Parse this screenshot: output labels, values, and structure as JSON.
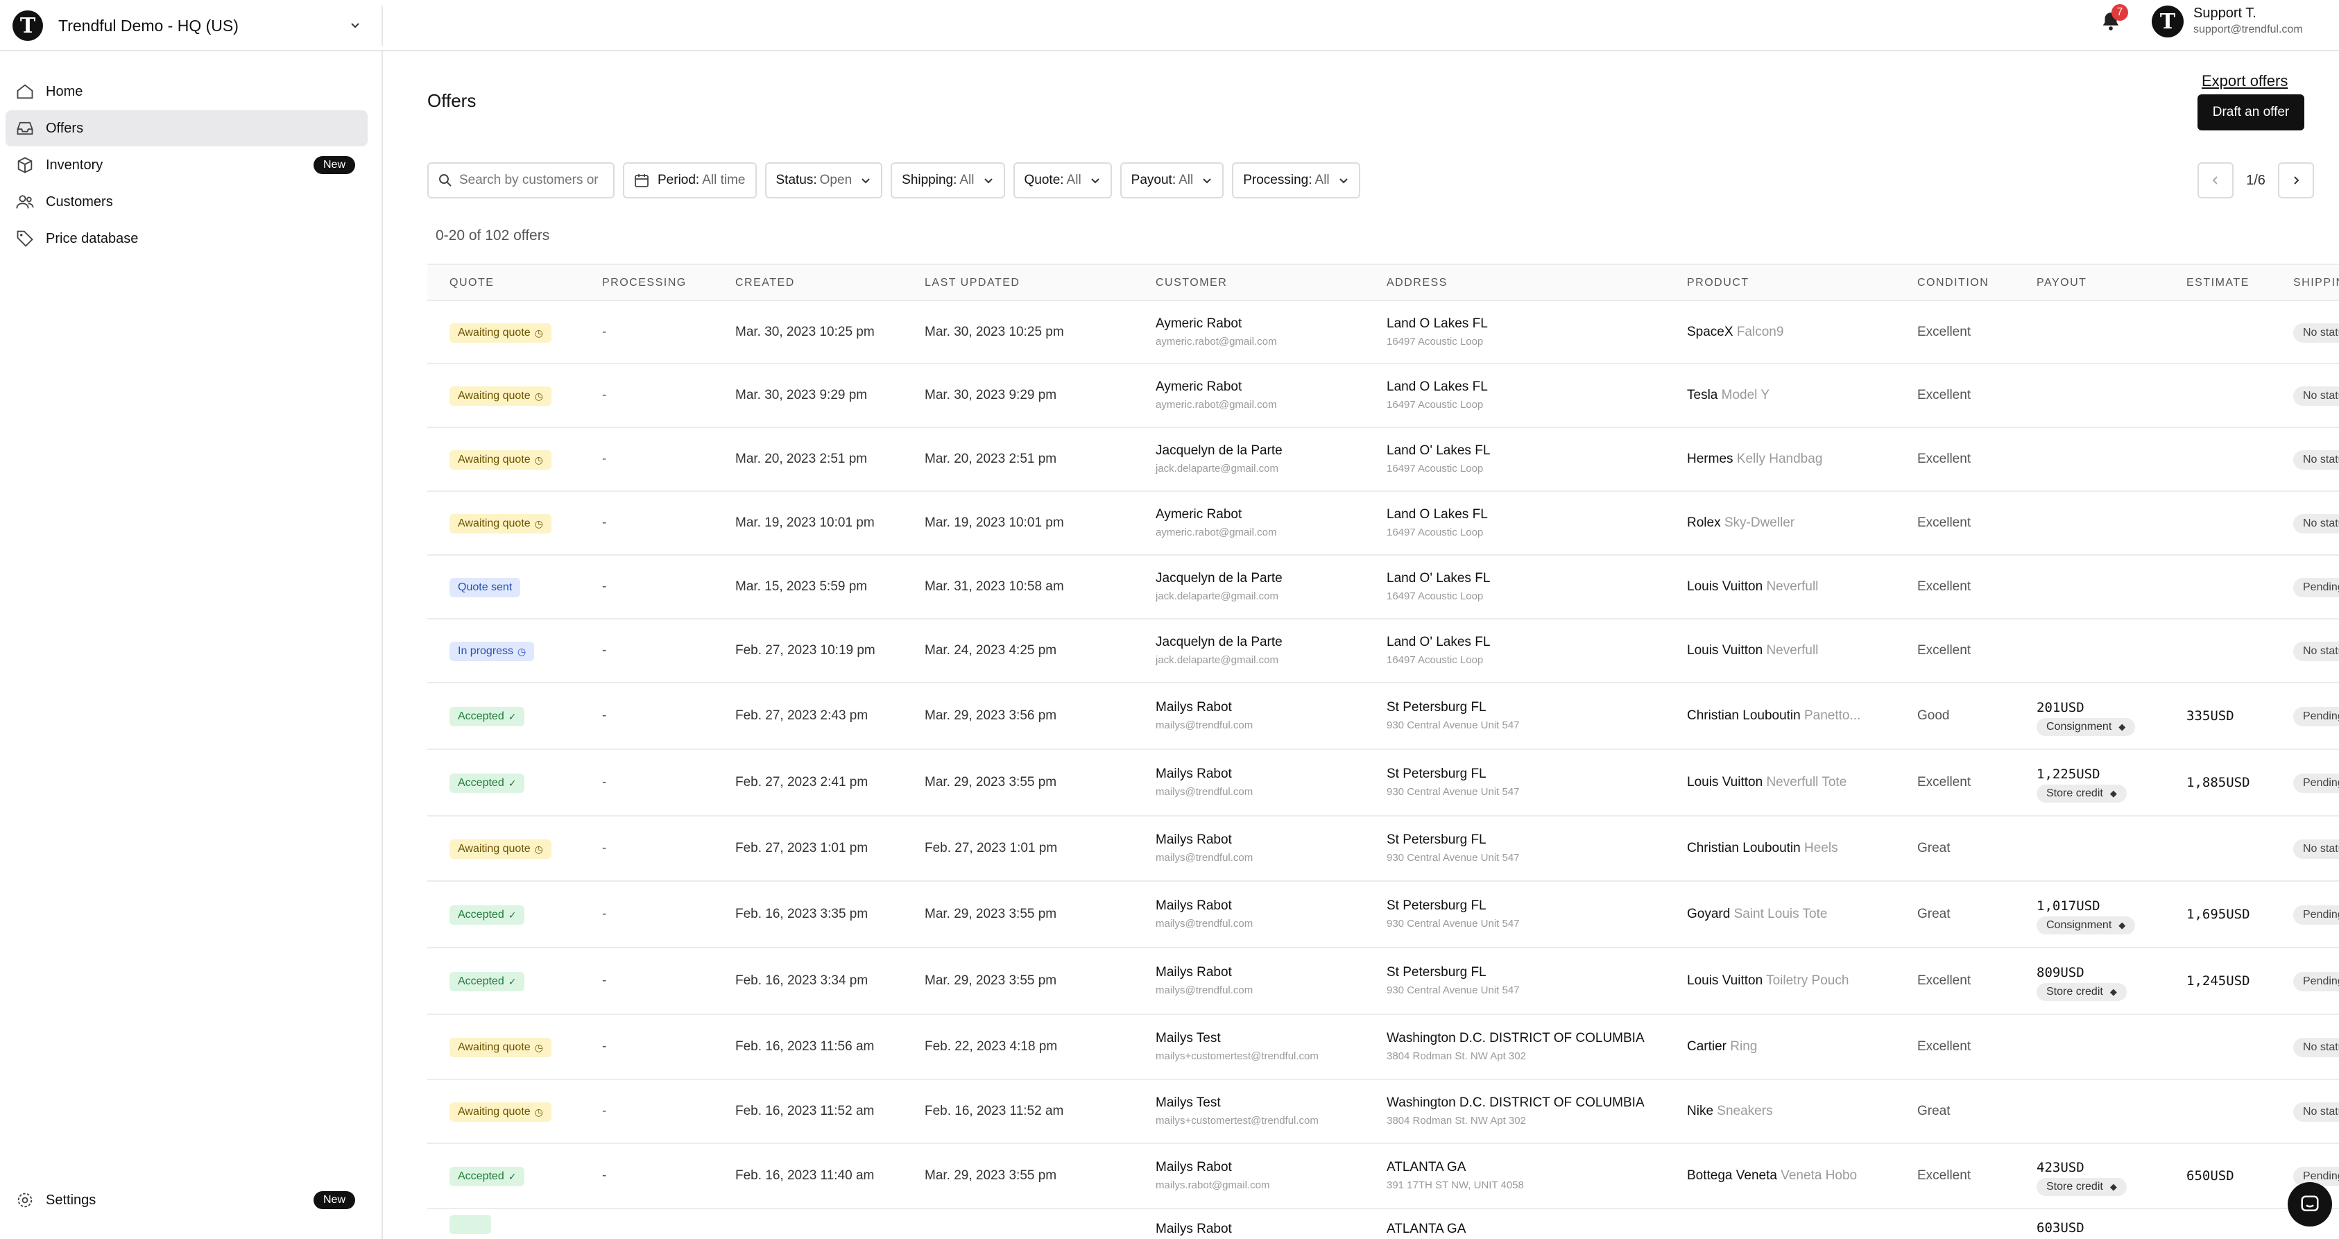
{
  "org": {
    "logo_letter": "T",
    "name": "Trendful Demo - HQ (US)"
  },
  "user": {
    "avatar_letter": "T",
    "name": "Support T.",
    "email": "support@trendful.com",
    "notifications": "7"
  },
  "nav": {
    "items": [
      {
        "key": "home",
        "label": "Home"
      },
      {
        "key": "offers",
        "label": "Offers"
      },
      {
        "key": "inventory",
        "label": "Inventory",
        "badge": "New"
      },
      {
        "key": "customers",
        "label": "Customers"
      },
      {
        "key": "price-database",
        "label": "Price database"
      }
    ],
    "settings": {
      "label": "Settings",
      "badge": "New"
    }
  },
  "page": {
    "title": "Offers",
    "export_label": "Export offers",
    "draft_label": "Draft an offer",
    "search_placeholder": "Search by customers or",
    "filters": [
      {
        "key": "period",
        "label": "Period:",
        "value": "All time"
      },
      {
        "key": "status",
        "label": "Status:",
        "value": "Open"
      },
      {
        "key": "shipping",
        "label": "Shipping:",
        "value": "All"
      },
      {
        "key": "quote",
        "label": "Quote:",
        "value": "All"
      },
      {
        "key": "payout",
        "label": "Payout:",
        "value": "All"
      },
      {
        "key": "processing",
        "label": "Processing:",
        "value": "All"
      }
    ],
    "pagination": "1/6",
    "count": "0-20 of 102 offers"
  },
  "table": {
    "columns": [
      "QUOTE",
      "PROCESSING",
      "CREATED",
      "LAST UPDATED",
      "CUSTOMER",
      "ADDRESS",
      "PRODUCT",
      "CONDITION",
      "PAYOUT",
      "ESTIMATE",
      "SHIPPING"
    ],
    "rows": [
      {
        "quote": "Awaiting quote",
        "quote_color": "yellow",
        "processing": "-",
        "created": "Mar. 30, 2023 10:25 pm",
        "updated": "Mar. 30, 2023 10:25 pm",
        "customer": "Aymeric Rabot",
        "email": "aymeric.rabot@gmail.com",
        "city": "Land O Lakes FL",
        "street": "16497 Acoustic Loop",
        "brand": "SpaceX",
        "model": "Falcon9",
        "condition": "Excellent",
        "payout": "",
        "payout_type": "",
        "estimate": "",
        "shipping": "No status"
      },
      {
        "quote": "Awaiting quote",
        "quote_color": "yellow",
        "processing": "-",
        "created": "Mar. 30, 2023 9:29 pm",
        "updated": "Mar. 30, 2023 9:29 pm",
        "customer": "Aymeric Rabot",
        "email": "aymeric.rabot@gmail.com",
        "city": "Land O Lakes FL",
        "street": "16497 Acoustic Loop",
        "brand": "Tesla",
        "model": "Model Y",
        "condition": "Excellent",
        "payout": "",
        "payout_type": "",
        "estimate": "",
        "shipping": "No status"
      },
      {
        "quote": "Awaiting quote",
        "quote_color": "yellow",
        "processing": "-",
        "created": "Mar. 20, 2023 2:51 pm",
        "updated": "Mar. 20, 2023 2:51 pm",
        "customer": "Jacquelyn de la Parte",
        "email": "jack.delaparte@gmail.com",
        "city": "Land O' Lakes FL",
        "street": "16497 Acoustic Loop",
        "brand": "Hermes",
        "model": "Kelly Handbag",
        "condition": "Excellent",
        "payout": "",
        "payout_type": "",
        "estimate": "",
        "shipping": "No status"
      },
      {
        "quote": "Awaiting quote",
        "quote_color": "yellow",
        "processing": "-",
        "created": "Mar. 19, 2023 10:01 pm",
        "updated": "Mar. 19, 2023 10:01 pm",
        "customer": "Aymeric Rabot",
        "email": "aymeric.rabot@gmail.com",
        "city": "Land O Lakes FL",
        "street": "16497 Acoustic Loop",
        "brand": "Rolex",
        "model": "Sky-Dweller",
        "condition": "Excellent",
        "payout": "",
        "payout_type": "",
        "estimate": "",
        "shipping": "No status"
      },
      {
        "quote": "Quote sent",
        "quote_color": "blue",
        "processing": "-",
        "created": "Mar. 15, 2023 5:59 pm",
        "updated": "Mar. 31, 2023 10:58 am",
        "customer": "Jacquelyn de la Parte",
        "email": "jack.delaparte@gmail.com",
        "city": "Land O' Lakes FL",
        "street": "16497 Acoustic Loop",
        "brand": "Louis Vuitton",
        "model": "Neverfull",
        "condition": "Excellent",
        "payout": "",
        "payout_type": "",
        "estimate": "",
        "shipping": "Pending"
      },
      {
        "quote": "In progress",
        "quote_color": "blue",
        "processing": "-",
        "created": "Feb. 27, 2023 10:19 pm",
        "updated": "Mar. 24, 2023 4:25 pm",
        "customer": "Jacquelyn de la Parte",
        "email": "jack.delaparte@gmail.com",
        "city": "Land O' Lakes FL",
        "street": "16497 Acoustic Loop",
        "brand": "Louis Vuitton",
        "model": "Neverfull",
        "condition": "Excellent",
        "payout": "",
        "payout_type": "",
        "estimate": "",
        "shipping": "No status"
      },
      {
        "quote": "Accepted",
        "quote_color": "green",
        "processing": "-",
        "created": "Feb. 27, 2023 2:43 pm",
        "updated": "Mar. 29, 2023 3:56 pm",
        "customer": "Mailys Rabot",
        "email": "mailys@trendful.com",
        "city": "St Petersburg FL",
        "street": "930 Central Avenue Unit 547",
        "brand": "Christian Louboutin",
        "model": "Panetto...",
        "condition": "Good",
        "payout": "201USD",
        "payout_type": "Consignment",
        "estimate": "335USD",
        "shipping": "Pending"
      },
      {
        "quote": "Accepted",
        "quote_color": "green",
        "processing": "-",
        "created": "Feb. 27, 2023 2:41 pm",
        "updated": "Mar. 29, 2023 3:55 pm",
        "customer": "Mailys Rabot",
        "email": "mailys@trendful.com",
        "city": "St Petersburg FL",
        "street": "930 Central Avenue Unit 547",
        "brand": "Louis Vuitton",
        "model": "Neverfull Tote",
        "condition": "Excellent",
        "payout": "1,225USD",
        "payout_type": "Store credit",
        "estimate": "1,885USD",
        "shipping": "Pending"
      },
      {
        "quote": "Awaiting quote",
        "quote_color": "yellow",
        "processing": "-",
        "created": "Feb. 27, 2023 1:01 pm",
        "updated": "Feb. 27, 2023 1:01 pm",
        "customer": "Mailys Rabot",
        "email": "mailys@trendful.com",
        "city": "St Petersburg FL",
        "street": "930 Central Avenue Unit 547",
        "brand": "Christian Louboutin",
        "model": "Heels",
        "condition": "Great",
        "payout": "",
        "payout_type": "",
        "estimate": "",
        "shipping": "No status"
      },
      {
        "quote": "Accepted",
        "quote_color": "green",
        "processing": "-",
        "created": "Feb. 16, 2023 3:35 pm",
        "updated": "Mar. 29, 2023 3:55 pm",
        "customer": "Mailys Rabot",
        "email": "mailys@trendful.com",
        "city": "St Petersburg FL",
        "street": "930 Central Avenue Unit 547",
        "brand": "Goyard",
        "model": "Saint Louis Tote",
        "condition": "Great",
        "payout": "1,017USD",
        "payout_type": "Consignment",
        "estimate": "1,695USD",
        "shipping": "Pending"
      },
      {
        "quote": "Accepted",
        "quote_color": "green",
        "processing": "-",
        "created": "Feb. 16, 2023 3:34 pm",
        "updated": "Mar. 29, 2023 3:55 pm",
        "customer": "Mailys Rabot",
        "email": "mailys@trendful.com",
        "city": "St Petersburg FL",
        "street": "930 Central Avenue Unit 547",
        "brand": "Louis Vuitton",
        "model": "Toiletry Pouch",
        "condition": "Excellent",
        "payout": "809USD",
        "payout_type": "Store credit",
        "estimate": "1,245USD",
        "shipping": "Pending"
      },
      {
        "quote": "Awaiting quote",
        "quote_color": "yellow",
        "processing": "-",
        "created": "Feb. 16, 2023 11:56 am",
        "updated": "Feb. 22, 2023 4:18 pm",
        "customer": "Mailys Test",
        "email": "mailys+customertest@trendful.com",
        "city": "Washington D.C. DISTRICT OF COLUMBIA",
        "street": "3804 Rodman St. NW Apt 302",
        "brand": "Cartier",
        "model": "Ring",
        "condition": "Excellent",
        "payout": "",
        "payout_type": "",
        "estimate": "",
        "shipping": "No status"
      },
      {
        "quote": "Awaiting quote",
        "quote_color": "yellow",
        "processing": "-",
        "created": "Feb. 16, 2023 11:52 am",
        "updated": "Feb. 16, 2023 11:52 am",
        "customer": "Mailys Test",
        "email": "mailys+customertest@trendful.com",
        "city": "Washington D.C. DISTRICT OF COLUMBIA",
        "street": "3804 Rodman St. NW Apt 302",
        "brand": "Nike",
        "model": "Sneakers",
        "condition": "Great",
        "payout": "",
        "payout_type": "",
        "estimate": "",
        "shipping": "No status"
      },
      {
        "quote": "Accepted",
        "quote_color": "green",
        "processing": "-",
        "created": "Feb. 16, 2023 11:40 am",
        "updated": "Mar. 29, 2023 3:55 pm",
        "customer": "Mailys Rabot",
        "email": "mailys.rabot@gmail.com",
        "city": "ATLANTA GA",
        "street": "391 17TH ST NW, UNIT 4058",
        "brand": "Bottega Veneta",
        "model": "Veneta Hobo",
        "condition": "Excellent",
        "payout": "423USD",
        "payout_type": "Store credit",
        "estimate": "650USD",
        "shipping": "Pending"
      }
    ],
    "partial_row": {
      "customer": "Mailys Rabot",
      "city": "ATLANTA GA",
      "payout": "603USD"
    }
  }
}
